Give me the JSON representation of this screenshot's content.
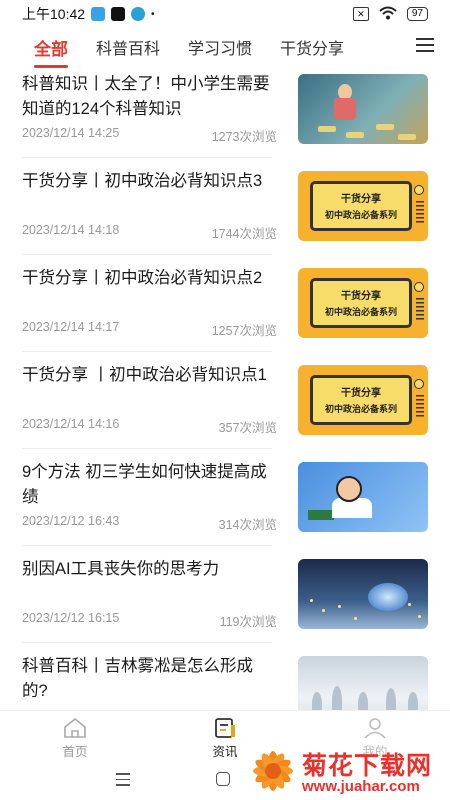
{
  "status_bar": {
    "time": "上午10:42",
    "battery": "97"
  },
  "tabs": [
    {
      "label": "全部",
      "active": true
    },
    {
      "label": "科普百科",
      "active": false
    },
    {
      "label": "学习习惯",
      "active": false
    },
    {
      "label": "干货分享",
      "active": false
    }
  ],
  "articles": [
    {
      "title": "科普知识丨太全了！中小学生需要知道的124个科普知识",
      "date": "2023/12/14 14:25",
      "views": "1273次浏览",
      "thumb": "kids-illustration"
    },
    {
      "title": "干货分享丨初中政治必背知识点3",
      "date": "2023/12/14 14:18",
      "views": "1744次浏览",
      "thumb": "tv-banner",
      "thumb_line1": "干货分享",
      "thumb_line2": "初中政治必备系列"
    },
    {
      "title": "干货分享丨初中政治必背知识点2",
      "date": "2023/12/14 14:17",
      "views": "1257次浏览",
      "thumb": "tv-banner",
      "thumb_line1": "干货分享",
      "thumb_line2": "初中政治必备系列"
    },
    {
      "title": "干货分享 丨初中政治必背知识点1",
      "date": "2023/12/14 14:16",
      "views": "357次浏览",
      "thumb": "tv-banner",
      "thumb_line1": "干货分享",
      "thumb_line2": "初中政治必备系列"
    },
    {
      "title": "9个方法 初三学生如何快速提高成绩",
      "date": "2023/12/12 16:43",
      "views": "314次浏览",
      "thumb": "student-illustration"
    },
    {
      "title": "别因AI工具丧失你的思考力",
      "date": "2023/12/12 16:15",
      "views": "119次浏览",
      "thumb": "city-night"
    },
    {
      "title": "科普百科丨吉林雾凇是怎么形成的?",
      "date": "",
      "views": "",
      "thumb": "snow-trees"
    }
  ],
  "bottom_nav": [
    {
      "label": "首页",
      "icon": "home-icon",
      "active": false
    },
    {
      "label": "资讯",
      "icon": "news-icon",
      "active": true
    },
    {
      "label": "我的",
      "icon": "user-icon",
      "active": false
    }
  ],
  "watermark": {
    "title": "菊花下载网",
    "url": "www.juahar.com"
  },
  "colors": {
    "accent": "#e23b2e",
    "text": "#1a1a1a",
    "meta": "#999999",
    "tv_bg": "#f6b12e"
  }
}
